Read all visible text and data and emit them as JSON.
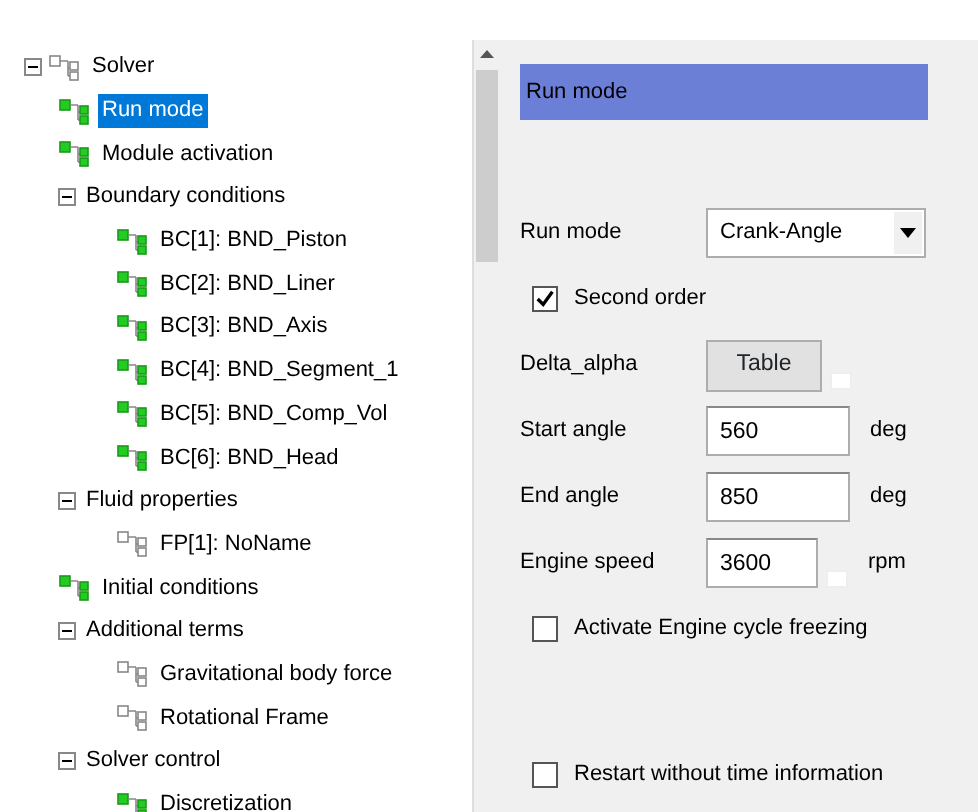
{
  "tree": [
    {
      "label": "Solver",
      "active": false,
      "selected": false,
      "expanded": true,
      "children": [
        {
          "label": "Run mode",
          "active": true,
          "selected": true
        },
        {
          "label": "Module activation",
          "active": true,
          "selected": false
        },
        {
          "label": "Boundary conditions",
          "selected": false,
          "expanded": true,
          "children": [
            {
              "label": "BC[1]: BND_Piston",
              "active": true,
              "selected": false
            },
            {
              "label": "BC[2]: BND_Liner",
              "active": true,
              "selected": false
            },
            {
              "label": "BC[3]: BND_Axis",
              "active": true,
              "selected": false
            },
            {
              "label": "BC[4]: BND_Segment_1",
              "active": true,
              "selected": false
            },
            {
              "label": "BC[5]: BND_Comp_Vol",
              "active": true,
              "selected": false
            },
            {
              "label": "BC[6]: BND_Head",
              "active": true,
              "selected": false
            }
          ]
        },
        {
          "label": "Fluid properties",
          "selected": false,
          "expanded": true,
          "children": [
            {
              "label": "FP[1]: NoName",
              "active": false,
              "selected": false
            }
          ]
        },
        {
          "label": "Initial conditions",
          "active": true,
          "selected": false
        },
        {
          "label": "Additional terms",
          "selected": false,
          "expanded": true,
          "children": [
            {
              "label": "Gravitational body force",
              "active": false,
              "selected": false
            },
            {
              "label": "Rotational Frame",
              "active": false,
              "selected": false
            }
          ]
        },
        {
          "label": "Solver control",
          "selected": false,
          "expanded": true,
          "children": [
            {
              "label": "Discretization",
              "active": true,
              "selected": false
            }
          ]
        }
      ]
    }
  ],
  "header": "Run mode",
  "form": [
    {
      "kind": "select",
      "label": "Run mode",
      "value": "Crank-Angle"
    },
    {
      "kind": "checkbox",
      "label": "Second order",
      "checked": true
    },
    {
      "kind": "button",
      "label": "Delta_alpha",
      "button": "Table",
      "more": true
    },
    {
      "kind": "number",
      "label": "Start angle",
      "value": "560",
      "unit": "deg",
      "more": false
    },
    {
      "kind": "number",
      "label": "End angle",
      "value": "850",
      "unit": "deg",
      "more": false
    },
    {
      "kind": "number",
      "label": "Engine speed",
      "value": "3600",
      "unit": "rpm",
      "more": true
    },
    {
      "kind": "checkbox",
      "label": "Activate Engine cycle freezing",
      "checked": false
    }
  ],
  "footer_options": [
    {
      "label": "Restart without time information",
      "checked": false
    }
  ]
}
